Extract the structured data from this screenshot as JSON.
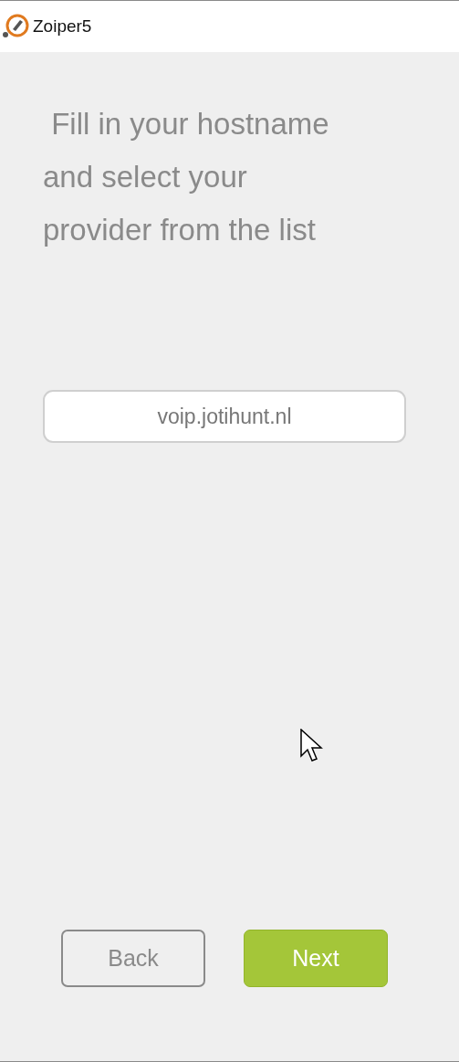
{
  "window": {
    "title": "Zoiper5"
  },
  "heading_lines": [
    " Fill in your hostname",
    "and select your",
    "provider from the list"
  ],
  "hostname_field": {
    "value": "voip.jotihunt.nl"
  },
  "buttons": [
    {
      "label": "Back",
      "kind": "secondary"
    },
    {
      "label": "Next",
      "kind": "primary"
    }
  ]
}
